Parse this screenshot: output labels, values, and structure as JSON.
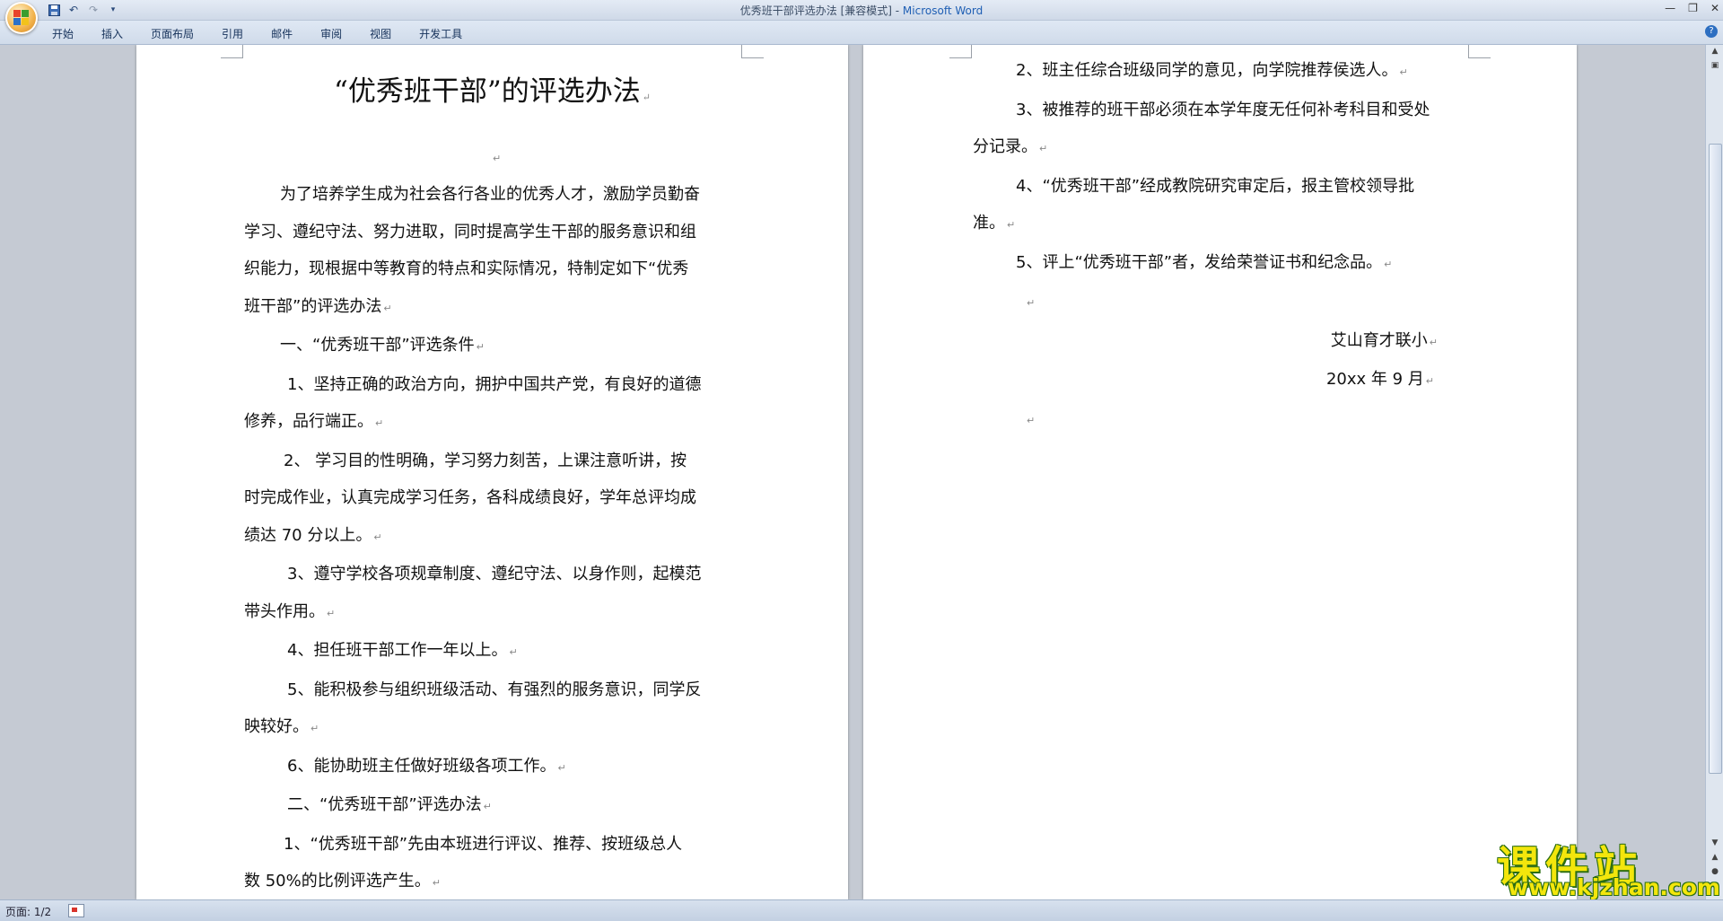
{
  "window": {
    "title": "优秀班干部评选办法 [兼容模式] - ",
    "app_name": "Microsoft Word",
    "controls": [
      "—",
      "❐",
      "✕"
    ]
  },
  "quick_access": {
    "save_icon": "save-icon",
    "undo_icon": "undo-icon",
    "redo_icon": "redo-icon",
    "more": "▾"
  },
  "ribbon": {
    "tabs": [
      "开始",
      "插入",
      "页面布局",
      "引用",
      "邮件",
      "审阅",
      "视图",
      "开发工具"
    ],
    "help": "?"
  },
  "page1": {
    "title": "“优秀班干部”的评选办法",
    "intro": [
      "为了培养学生成为社会各行各业的优秀人才，激励学员勤奋",
      "学习、遵纪守法、努力进取，同时提高学生干部的服务意识和组",
      "织能力，现根据中等教育的特点和实际情况，特制定如下“优秀",
      "班干部”的评选办法"
    ],
    "section1": "一、“优秀班干部”评选条件",
    "c1": [
      "1、坚持正确的政治方向，拥护中国共产党，有良好的道德",
      "修养，品行端正。"
    ],
    "c2": [
      "2、 学习目的性明确，学习努力刻苦，上课注意听讲，按",
      "时完成作业，认真完成学习任务，各科成绩良好，学年总评均成",
      "绩达 70 分以上。"
    ],
    "c3": [
      "3、遵守学校各项规章制度、遵纪守法、以身作则，起模范",
      "带头作用。"
    ],
    "c4": "4、担任班干部工作一年以上。",
    "c5": [
      "5、能积极参与组织班级活动、有强烈的服务意识，同学反",
      "映较好。"
    ],
    "c6": "6、能协助班主任做好班级各项工作。",
    "section2": "二、“优秀班干部”评选办法",
    "m1": [
      "1、“优秀班干部”先由本班进行评议、推荐、按班级总人",
      "数 50%的比例评选产生。"
    ]
  },
  "page2": {
    "m2": "2、班主任综合班级同学的意见，向学院推荐侯选人。",
    "m3": [
      "3、被推荐的班干部必须在本学年度无任何补考科目和受处",
      "分记录。"
    ],
    "m4": [
      "4、“优秀班干部”经成教院研究审定后，报主管校领导批",
      "准。"
    ],
    "m5": "5、评上“优秀班干部”者，发给荣誉证书和纪念品。",
    "signature": "艾山育才联小",
    "date": "20xx 年 9 月"
  },
  "paragraph_mark": "↵",
  "status": {
    "page": "页面: 1/2"
  },
  "watermark": {
    "brand": "课件站",
    "url": "www.kjzhan.com"
  }
}
